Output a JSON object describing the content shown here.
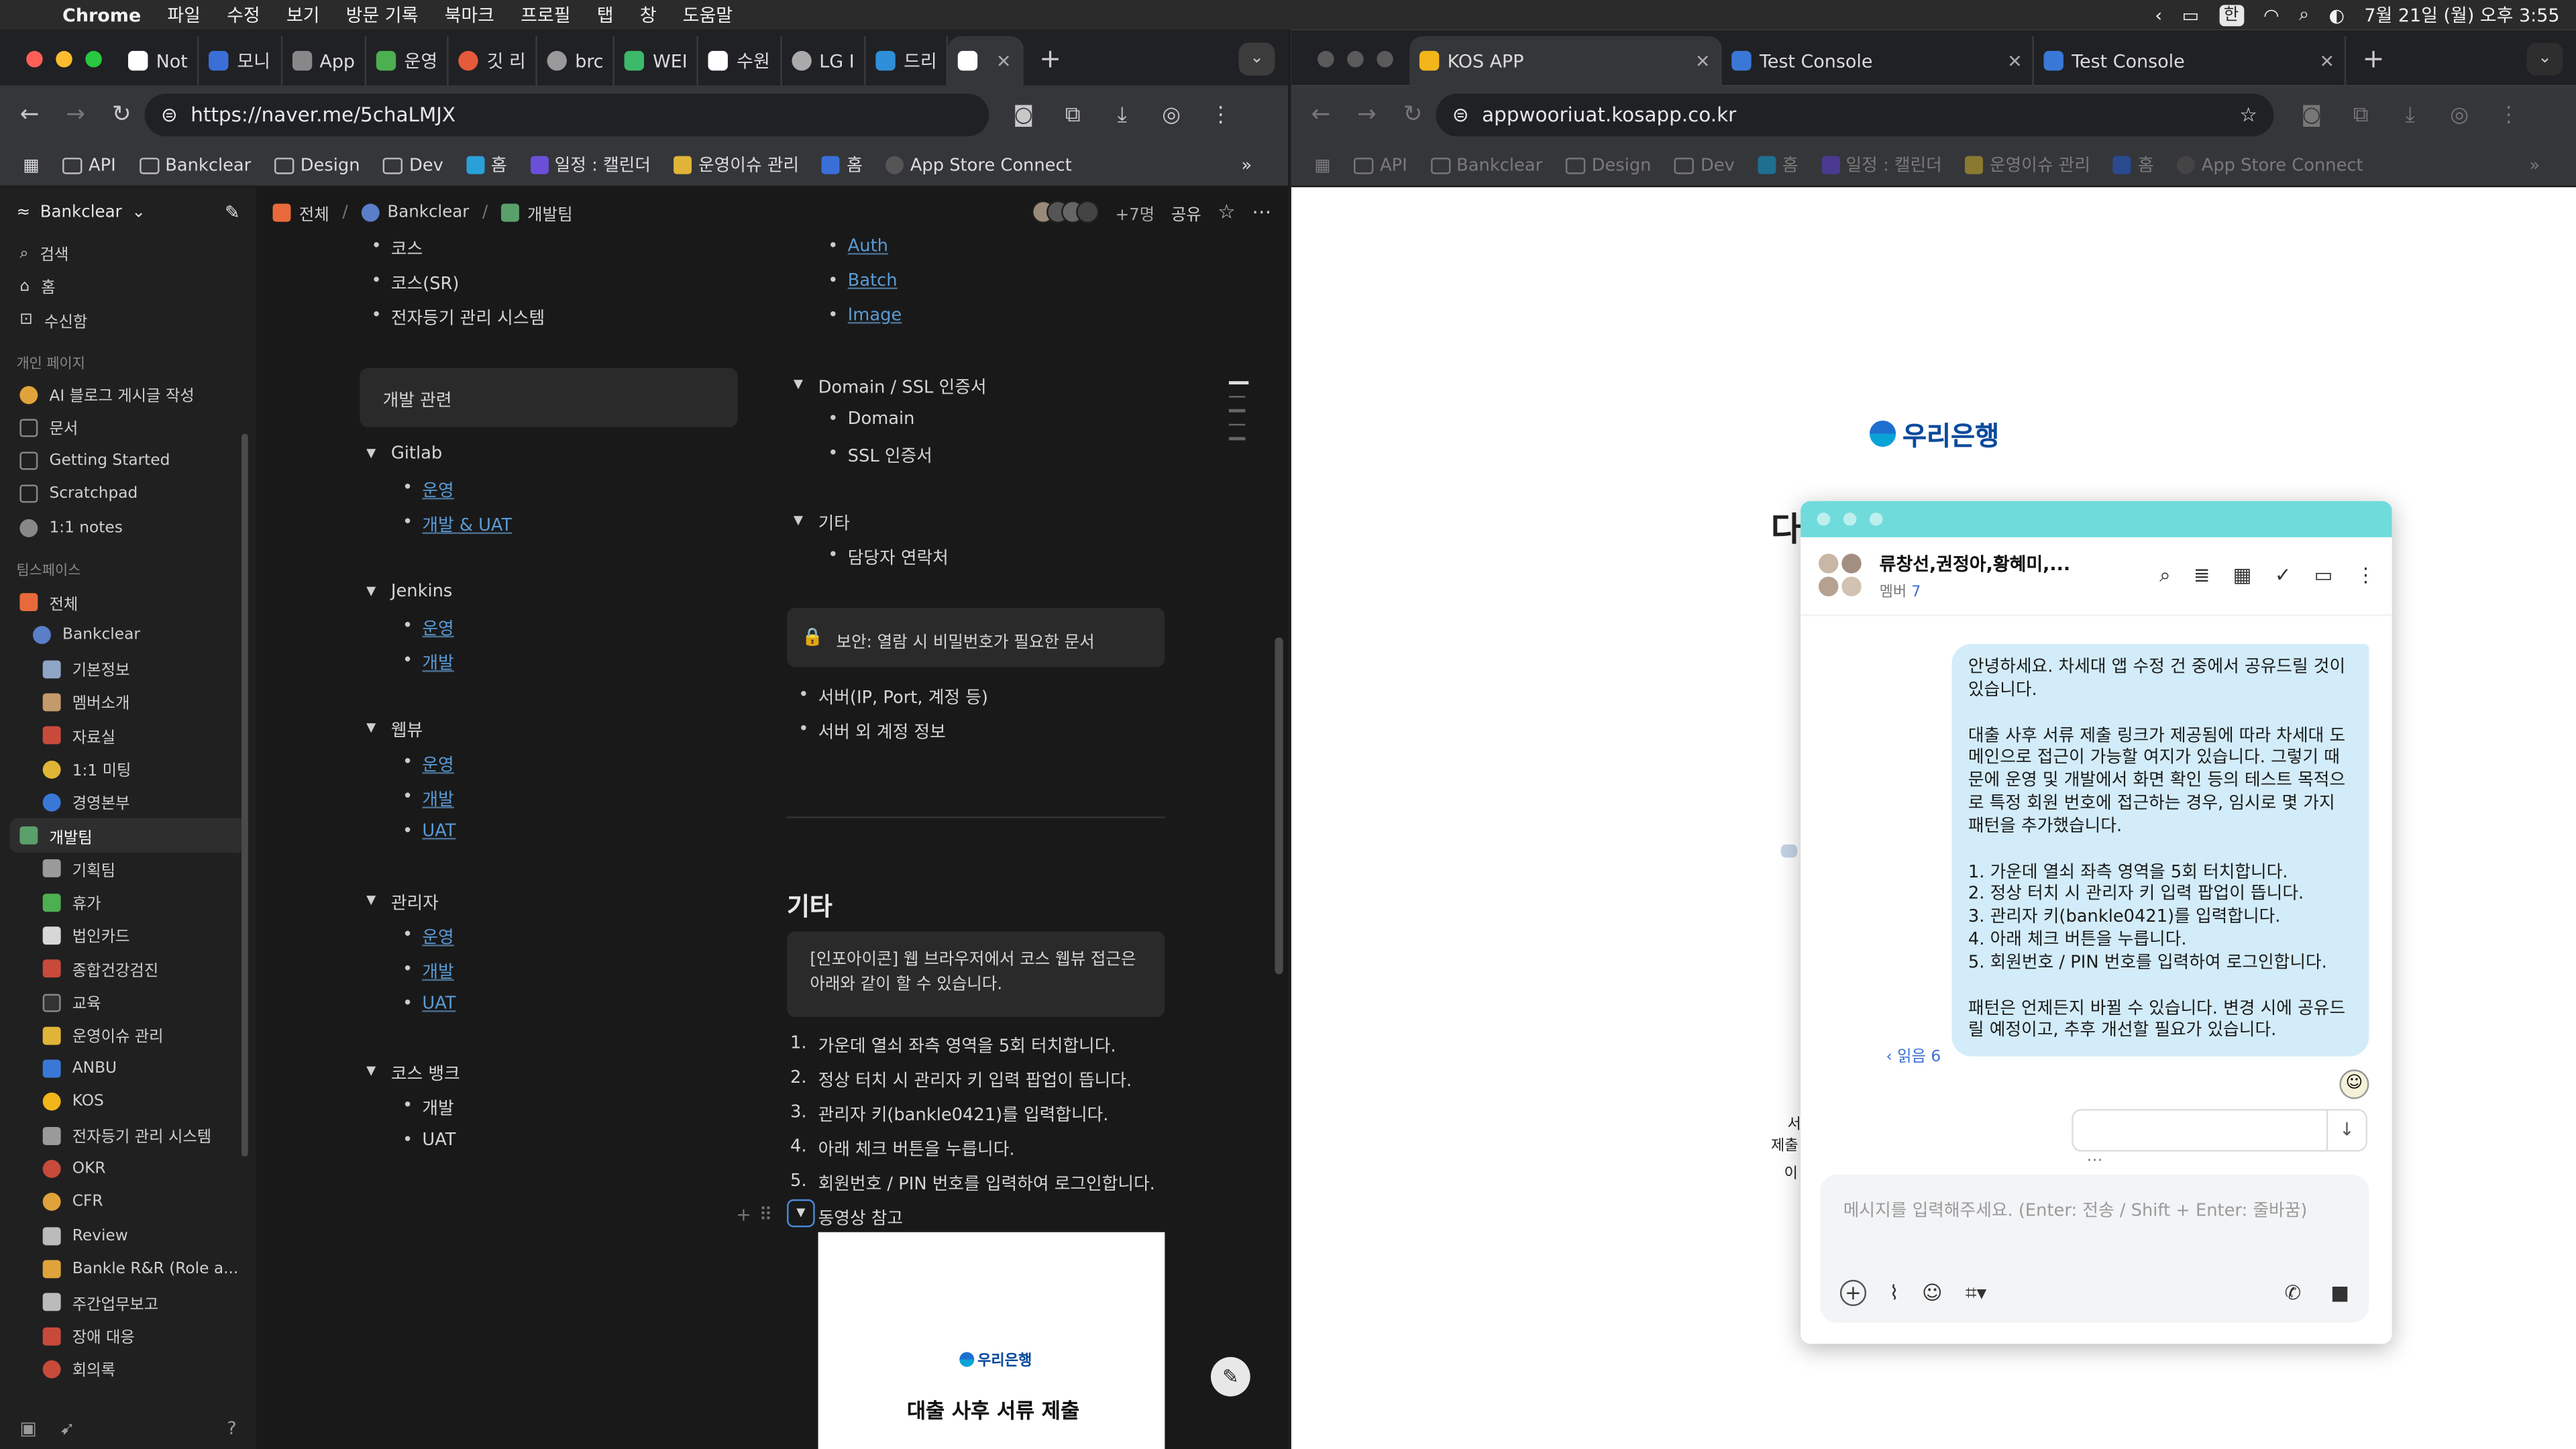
{
  "menubar": {
    "app": "Chrome",
    "items": [
      "파일",
      "수정",
      "보기",
      "방문 기록",
      "북마크",
      "프로필",
      "탭",
      "창",
      "도움말"
    ],
    "ime": "한",
    "clock": "7월 21일 (월) 오후 3:55"
  },
  "left_window": {
    "tabs": [
      {
        "label": "Not",
        "color": "#ffffff"
      },
      {
        "label": "모니",
        "color": "#3b6fd8"
      },
      {
        "label": "App",
        "color": "#888888"
      },
      {
        "label": "운영",
        "color": "#4caf50"
      },
      {
        "label": "깃 리",
        "color": "#e55a3b"
      },
      {
        "label": "brc",
        "color": "#999999"
      },
      {
        "label": "WEI",
        "color": "#3cba6a"
      },
      {
        "label": "수원",
        "color": "#ffffff"
      },
      {
        "label": "LG I",
        "color": "#aaaaaa"
      },
      {
        "label": "드리",
        "color": "#2e8fd8"
      },
      {
        "label": "",
        "color": "#ffffff"
      }
    ],
    "url": "https://naver.me/5chaLMJX",
    "bookmarks": [
      {
        "label": "",
        "kind": "grid"
      },
      {
        "label": "API",
        "kind": "folder"
      },
      {
        "label": "Bankclear",
        "kind": "folder"
      },
      {
        "label": "Design",
        "kind": "folder"
      },
      {
        "label": "Dev",
        "kind": "folder"
      },
      {
        "label": "홈",
        "kind": "site"
      },
      {
        "label": "일정 : 캘린더",
        "kind": "site"
      },
      {
        "label": "운영이슈 관리",
        "kind": "site"
      },
      {
        "label": "홈",
        "kind": "site"
      },
      {
        "label": "App Store Connect",
        "kind": "site"
      }
    ]
  },
  "sidebar": {
    "workspace": "Bankclear",
    "top_items": [
      "검색",
      "홈",
      "수신함"
    ],
    "personal_header": "개인 페이지",
    "personal_items": [
      "AI 블로그 게시글 작성",
      "문서",
      "Getting Started",
      "Scratchpad",
      "1:1 notes"
    ],
    "team_header": "팀스페이스",
    "team_items": [
      "전체",
      "Bankclear",
      "기본정보",
      "멤버소개",
      "자료실",
      "1:1 미팅",
      "경영본부",
      "개발팀",
      "기획팀",
      "휴가",
      "법인카드",
      "종합건강검진",
      "교육",
      "운영이슈 관리",
      "ANBU",
      "KOS",
      "전자등기 관리 시스템",
      "OKR",
      "CFR",
      "Review",
      "Bankle R&R (Role a...",
      "주간업무보고",
      "장애 대응",
      "회의록"
    ],
    "active_item": "개발팀"
  },
  "breadcrumb": {
    "items": [
      "전체",
      "Bankclear",
      "개발팀"
    ],
    "share_count": "+7명",
    "share_label": "공유"
  },
  "doc": {
    "col1_top": [
      "코스",
      "코스(SR)",
      "전자등기 관리 시스템"
    ],
    "dev_callout": "개발 관련",
    "gitlab": {
      "title": "Gitlab",
      "links": [
        "운영",
        "개발 & UAT"
      ]
    },
    "jenkins": {
      "title": "Jenkins",
      "links": [
        "운영",
        "개발"
      ]
    },
    "webview": {
      "title": "웹뷰",
      "links": [
        "운영",
        "개발",
        "UAT"
      ]
    },
    "admin": {
      "title": "관리자",
      "links": [
        "운영",
        "개발",
        "UAT"
      ]
    },
    "kos_bank": {
      "title": "코스 뱅크",
      "items": [
        "개발",
        "UAT"
      ]
    },
    "col2_links": [
      "Auth",
      "Batch",
      "Image"
    ],
    "domain": {
      "title": "Domain / SSL 인증서",
      "items": [
        "Domain",
        "SSL 인증서"
      ]
    },
    "etc_toggle": {
      "title": "기타",
      "items": [
        "담당자 연락처"
      ]
    },
    "security_callout": "보안: 열람 시 비밀번호가 필요한 문서",
    "security_items": [
      "서버(IP, Port, 계정 등)",
      "서버 외 계정 정보"
    ],
    "etc_heading": "기타",
    "info_callout": "[인포아이콘] 웹 브라우저에서 코스 웹뷰 접근은 아래와 같이 할 수 있습니다.",
    "steps": [
      "가운데 열쇠 좌측 영역을 5회 터치합니다.",
      "정상 터치 시 관리자 키 입력 팝업이 뜹니다.",
      "관리자 키(bankle0421)를 입력합니다.",
      "아래 체크 버튼을 누릅니다.",
      "회원번호 / PIN 번호를 입력하여 로그인합니다."
    ],
    "video_toggle": "동영상 참고",
    "video_logo": "우리은행",
    "video_title": "대출 사후 서류 제출"
  },
  "right_window": {
    "tabs": [
      {
        "label": "KOS APP",
        "color": "#f2b51a"
      },
      {
        "label": "Test Console",
        "color": "#3a78d8"
      },
      {
        "label": "Test Console",
        "color": "#3a78d8"
      }
    ],
    "url": "appwooriuat.kosapp.co.kr",
    "bookmarks": [
      "API",
      "Bankclear",
      "Design",
      "Dev",
      "홈",
      "일정 : 캘린더",
      "운영이슈 관리",
      "홈",
      "App Store Connect"
    ],
    "page_logo": "우리은행",
    "page_bg_big": "다",
    "page_bg_small": [
      "서",
      "제출",
      "이"
    ]
  },
  "chat": {
    "title": "류창선,권정아,황혜미,...",
    "member_label": "멤버",
    "member_count": "7",
    "paragraphs": [
      "안녕하세요. 차세대 앱 수정 건 중에서 공유드릴 것이 있습니다.",
      "대출 사후 서류 제출 링크가 제공됨에 따라 차세대 도메인으로 접근이 가능할 여지가 있습니다. 그렇기 때문에 운영 및 개발에서 화면 확인 등의 테스트 목적으로 특정 회원 번호에 접근하는 경우, 임시로 몇 가지 패턴을 추가했습니다.",
      "1. 가운데 열쇠 좌측 영역을 5회 터치합니다.\n2. 정상 터치 시 관리자 키 입력 팝업이 뜹니다.\n3. 관리자 키(bankle0421)를 입력합니다.\n4. 아래 체크 버튼을 누릅니다.\n5. 회원번호 / PIN 번호를 입력하여 로그인합니다.",
      "패턴은 언제든지 바뀔 수 있습니다. 변경 시에 공유드릴 예정이고, 추후 개선할 필요가 있습니다."
    ],
    "read_count": "‹ 읽음 6",
    "composer_placeholder": "메시지를 입력해주세요. (Enter: 전송 / Shift + Enter: 줄바꿈)"
  },
  "colors": {
    "notion_bg": "#191919",
    "sidebar_bg": "#202020",
    "link": "#5a9bd6",
    "chat_header": "#70dbdb",
    "bubble": "#d3ecf9",
    "woori_blue": "#0a4a9c"
  }
}
